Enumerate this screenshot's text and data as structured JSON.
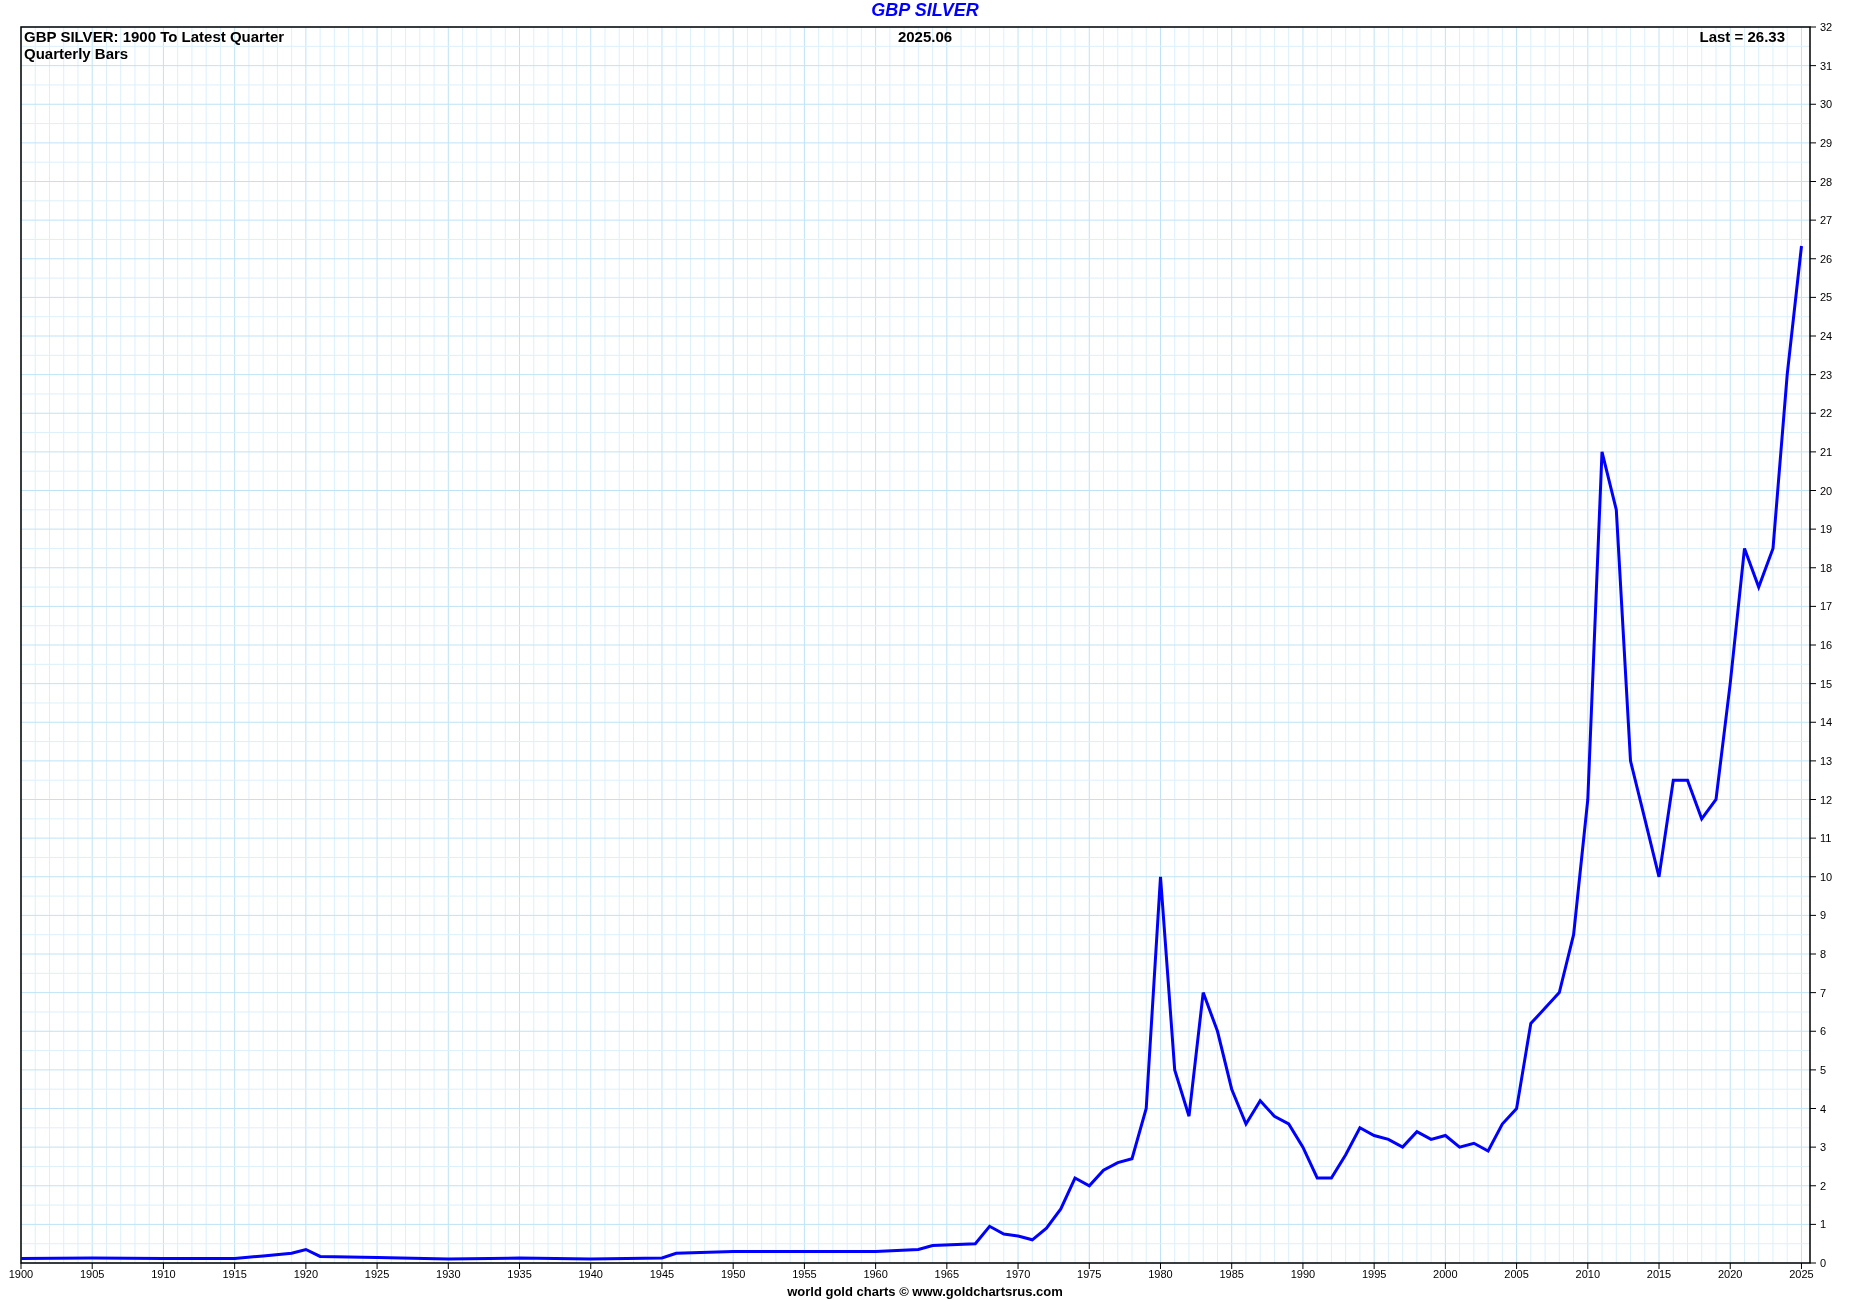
{
  "chart_header": {
    "subtitle": "GBP SILVER: 1900 To Latest Quarter",
    "bar_type": "Quarterly Bars",
    "date": "2025.06",
    "last": "Last = 26.33"
  },
  "chart_data": {
    "type": "line",
    "title": "GBP SILVER",
    "xlim": [
      1900,
      2025.6
    ],
    "ylim": [
      0,
      32
    ],
    "x": [
      1900,
      1905,
      1910,
      1915,
      1917,
      1919,
      1920,
      1921,
      1925,
      1930,
      1935,
      1940,
      1945,
      1946,
      1950,
      1955,
      1960,
      1963,
      1964,
      1967,
      1968,
      1969,
      1970,
      1971,
      1972,
      1973,
      1974,
      1975,
      1976,
      1977,
      1978,
      1979,
      1980,
      1981,
      1982,
      1983,
      1984,
      1985,
      1986,
      1987,
      1988,
      1989,
      1990,
      1991,
      1992,
      1993,
      1994,
      1995,
      1996,
      1997,
      1998,
      1999,
      2000,
      2001,
      2002,
      2003,
      2004,
      2005,
      2006,
      2007,
      2008,
      2009,
      2010,
      2011,
      2012,
      2013,
      2014,
      2015,
      2016,
      2017,
      2018,
      2019,
      2020,
      2021,
      2022,
      2023,
      2024,
      2025
    ],
    "grid": true,
    "series": [
      {
        "color": "#0000ff",
        "values": [
          0.12,
          0.13,
          0.12,
          0.12,
          0.18,
          0.25,
          0.35,
          0.17,
          0.14,
          0.1,
          0.13,
          0.1,
          0.13,
          0.25,
          0.3,
          0.3,
          0.3,
          0.35,
          0.45,
          0.5,
          0.95,
          0.75,
          0.7,
          0.6,
          0.9,
          1.4,
          2.2,
          2.0,
          2.4,
          2.6,
          2.7,
          4.0,
          10.0,
          5.0,
          3.8,
          7.0,
          6.0,
          4.5,
          3.6,
          4.2,
          3.8,
          3.6,
          3.0,
          2.2,
          2.2,
          2.8,
          3.5,
          3.3,
          3.2,
          3.0,
          3.4,
          3.2,
          3.3,
          3.0,
          3.1,
          2.9,
          3.6,
          4.0,
          6.2,
          6.6,
          7.0,
          8.5,
          12.0,
          21.0,
          19.5,
          13.0,
          11.5,
          10.0,
          12.5,
          12.5,
          11.5,
          12.0,
          15.0,
          18.5,
          17.5,
          18.5,
          23.0,
          26.33
        ]
      }
    ],
    "xticks": [
      1900,
      1905,
      1910,
      1915,
      1920,
      1925,
      1930,
      1935,
      1940,
      1945,
      1950,
      1955,
      1960,
      1965,
      1970,
      1975,
      1980,
      1985,
      1990,
      1995,
      2000,
      2005,
      2010,
      2015,
      2020,
      2025
    ],
    "yticks": [
      0,
      1,
      2,
      3,
      4,
      5,
      6,
      7,
      8,
      9,
      10,
      11,
      12,
      13,
      14,
      15,
      16,
      17,
      18,
      19,
      20,
      21,
      22,
      23,
      24,
      25,
      26,
      27,
      28,
      29,
      30,
      31,
      32
    ]
  },
  "footer": "world gold charts © www.goldchartsrus.com"
}
